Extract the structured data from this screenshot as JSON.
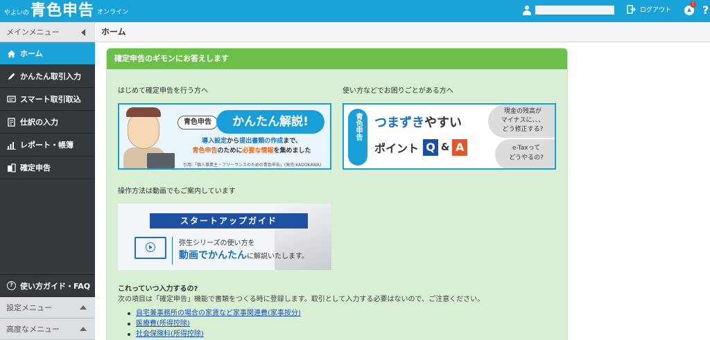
{
  "header": {
    "logo_prefix": "やよいの",
    "logo_main": "青色申告",
    "logo_suffix": "オンライン",
    "logout": "ログアウト",
    "notice_count": "!",
    "help": "?"
  },
  "sidebar": {
    "title": "メインメニュー",
    "items": [
      {
        "label": "ホーム",
        "icon": "home-icon"
      },
      {
        "label": "かんたん取引入力",
        "icon": "pencil-icon"
      },
      {
        "label": "スマート取引取込",
        "icon": "import-icon"
      },
      {
        "label": "仕訳の入力",
        "icon": "journal-icon"
      },
      {
        "label": "レポート・帳簿",
        "icon": "report-icon"
      },
      {
        "label": "確定申告",
        "icon": "tax-return-icon"
      }
    ],
    "guide": "使い方ガイド・FAQ",
    "settings": "設定メニュー",
    "advanced": "高度なメニュー"
  },
  "main": {
    "page_title": "ホーム",
    "panel_title": "確定申告のギモンにお答えします",
    "label_first": "はじめて確定申告を行う方へ",
    "label_trouble": "使い方などでお困りごとがある方へ",
    "label_video": "操作方法は動画でもご案内しています",
    "banner1": {
      "pill": "青色申告",
      "big": "かんたん解説!",
      "sub_line1_a": "導入設定",
      "sub_line1_b": "から",
      "sub_line1_c": "提出書類の作成",
      "sub_line1_d": "まで、",
      "sub_line2_a": "青色申告",
      "sub_line2_b": "のために",
      "sub_line2_c": "必要な情報",
      "sub_line2_d": "を集めました",
      "cite": "引用:「個人事業主・フリーランスのための青色申告」(発売:KADOKAWA)"
    },
    "banner2": {
      "tag": "青色申告",
      "t1_a": "つまずき",
      "t1_b": "やすい",
      "t2": "ポイント",
      "q": "Q",
      "amp": "&",
      "a": "A",
      "bubble1": "現金の残高が\nマイナスに、、、\nどう修正する?",
      "bubble2": "e-Taxって\nどうやるの?"
    },
    "banner3": {
      "bar": "スタートアップガイド",
      "line1": "弥生シリーズの使い方を",
      "line2_a": "動画でかんたん",
      "line2_b": "に解説いたします。"
    },
    "question": "これっていつ入力するの?",
    "description": "次の項目は「確定申告」機能で書類をつくる時に登録します。取引として入力する必要はないので、ご注意ください。",
    "links": [
      "自宅兼事務所の場合の家賃など家事関連費(家事按分)",
      "医療費(所得控除)",
      "社会保険料(所得控除)"
    ]
  }
}
